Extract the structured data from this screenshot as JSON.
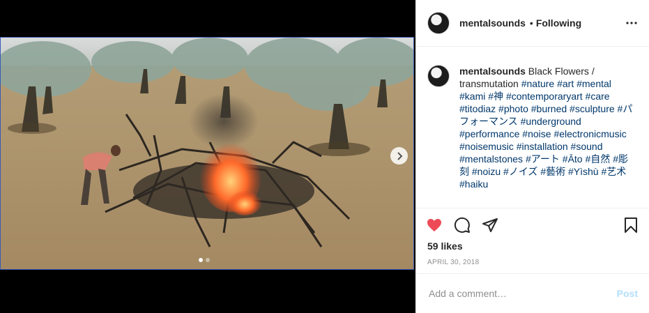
{
  "post": {
    "username": "mentalsounds",
    "separator": "•",
    "follow_state": "Following",
    "more_icon": "more-horizontal-icon",
    "avatar_icon": "avatar-image"
  },
  "media": {
    "image_description_icon": "photo-burning-tree",
    "carousel_next_icon": "chevron-right-icon",
    "carousel_total": 2,
    "carousel_current": 1
  },
  "caption": {
    "username": "mentalsounds",
    "text": "Black Flowers / transmutation",
    "hashtags": [
      "#nature",
      "#art",
      "#mental",
      "#kami",
      "#神",
      "#contemporaryart",
      "#care",
      "#titodiaz",
      "#photo",
      "#burned",
      "#sculpture",
      "#パフォーマンス",
      "#underground",
      "#performance",
      "#noise",
      "#electronicmusic",
      "#noisemusic",
      "#installation",
      "#sound",
      "#mentalstones",
      "#アート",
      "#Āto",
      "#自然",
      "#彫刻",
      "#noizu",
      "#ノイズ",
      "#藝術",
      "#Yìshù",
      "#艺术",
      "#haiku"
    ]
  },
  "actions": {
    "like_icon": "heart-filled-icon",
    "comment_icon": "comment-icon",
    "share_icon": "share-icon",
    "save_icon": "bookmark-icon",
    "like_color": "#ed4956"
  },
  "likes": "59 likes",
  "date": "APRIL 30, 2018",
  "comment": {
    "placeholder": "Add a comment…",
    "post_label": "Post"
  }
}
